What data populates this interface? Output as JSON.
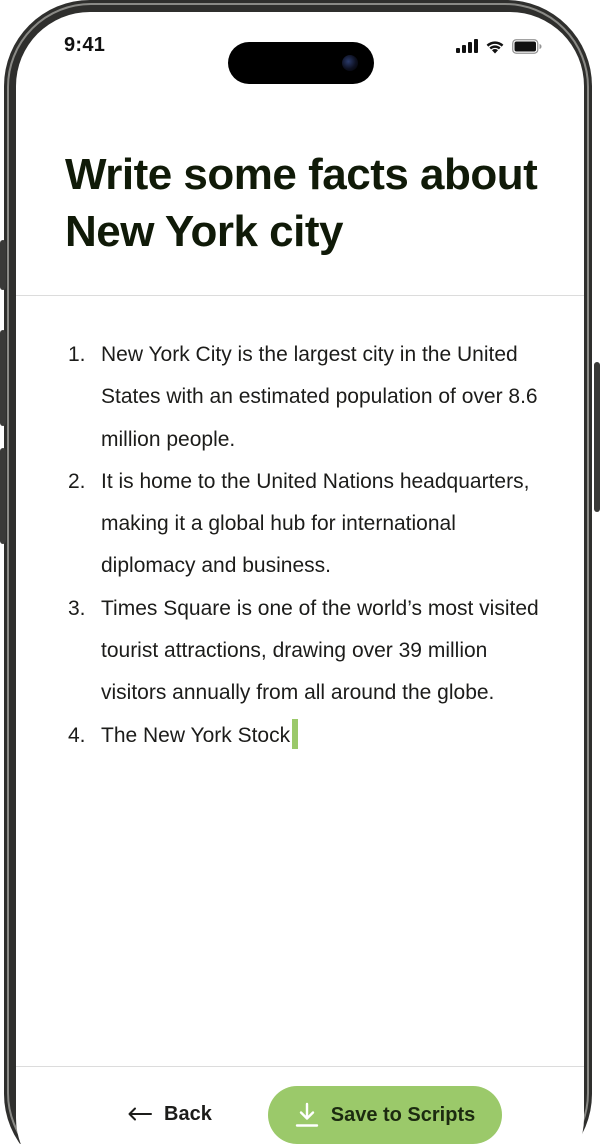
{
  "status_bar": {
    "time": "9:41",
    "icons": [
      "cellular-signal-icon",
      "wifi-icon",
      "battery-icon"
    ]
  },
  "title": "Write some facts about New York city",
  "facts": [
    {
      "number": "1.",
      "text": "New York City is the largest city in the United States with an estimated population of over 8.6 million people."
    },
    {
      "number": "2.",
      "text": "It is home to the United Nations headquarters, making it a global hub for international diplomacy and business."
    },
    {
      "number": "3.",
      "text": "Times Square is one of the world’s most visited tourist attractions, drawing over 39 million visitors annually from all around the globe."
    },
    {
      "number": "4.",
      "text": "The New York Stock"
    }
  ],
  "footer": {
    "back_label": "Back",
    "back_icon": "arrow-left-icon",
    "save_label": "Save to Scripts",
    "save_icon": "download-icon"
  },
  "colors": {
    "accent": "#9bc96a",
    "title": "#101a08",
    "text": "#1c1c1a"
  }
}
